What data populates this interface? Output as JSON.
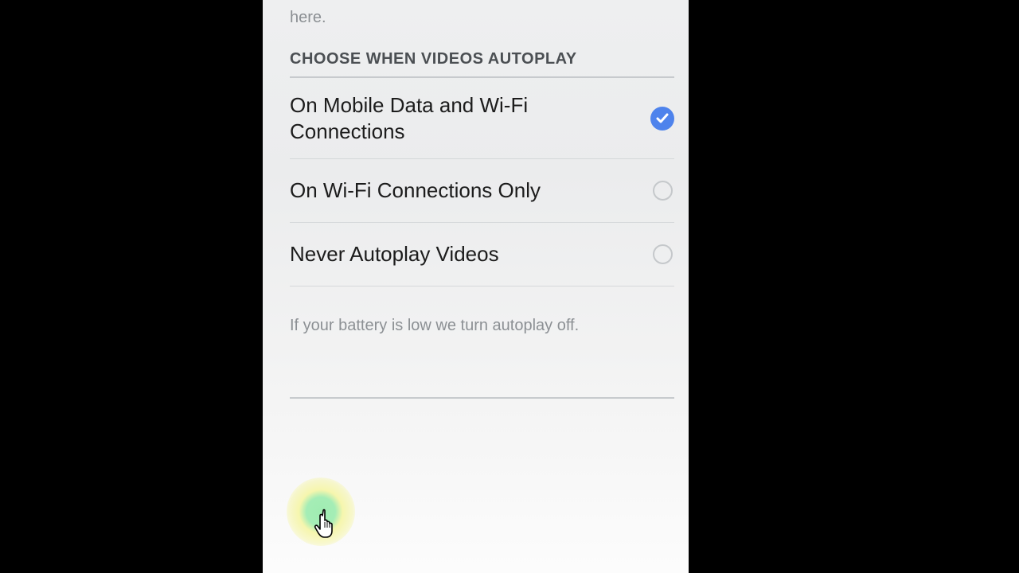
{
  "intro_fragment": "here.",
  "section_title": "CHOOSE WHEN VIDEOS AUTOPLAY",
  "options": [
    {
      "label": "On Mobile Data and Wi-Fi Connections",
      "selected": true
    },
    {
      "label": "On Wi-Fi Connections Only",
      "selected": false
    },
    {
      "label": "Never Autoplay Videos",
      "selected": false
    }
  ],
  "footnote": "If your battery is low we turn autoplay off."
}
